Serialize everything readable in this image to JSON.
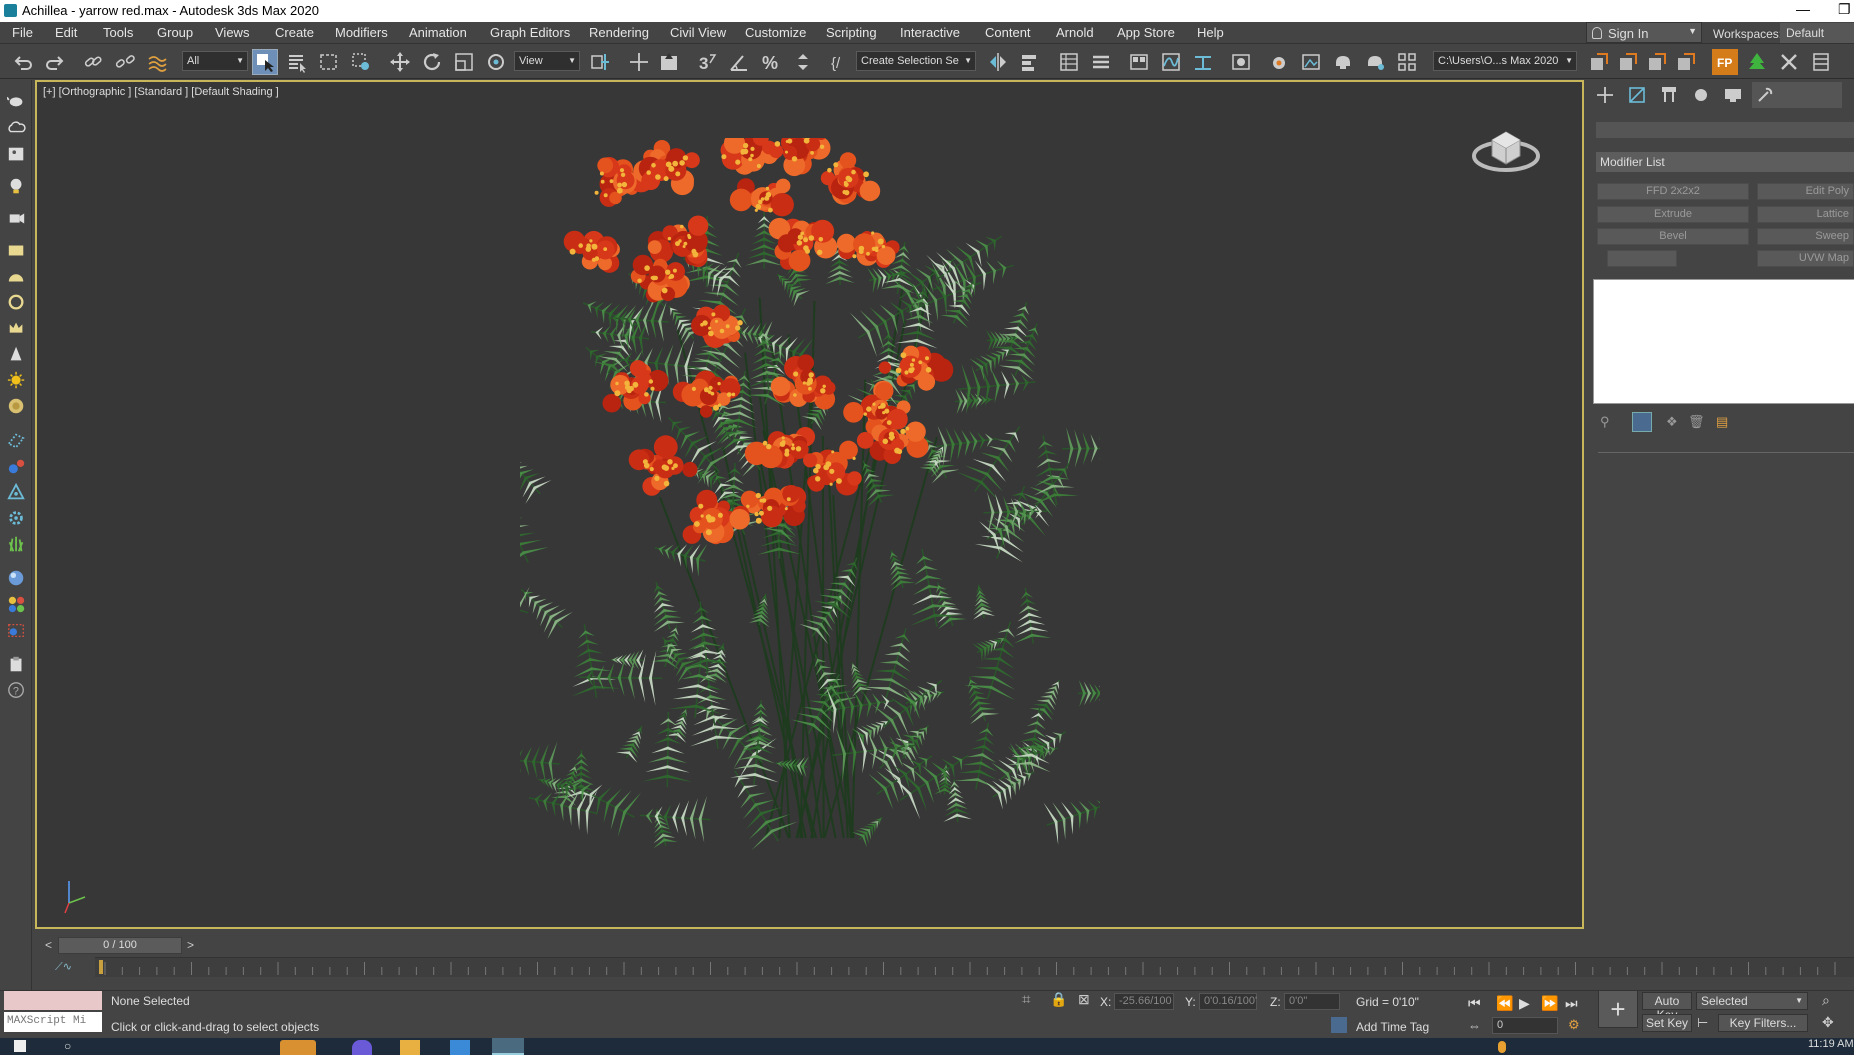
{
  "window": {
    "title": "Achillea - yarrow red.max - Autodesk 3ds Max 2020"
  },
  "menu": [
    "File",
    "Edit",
    "Tools",
    "Group",
    "Views",
    "Create",
    "Modifiers",
    "Animation",
    "Graph Editors",
    "Rendering",
    "Civil View",
    "Customize",
    "Scripting",
    "Interactive",
    "Content",
    "Arnold",
    "App Store",
    "Help"
  ],
  "account": {
    "sign_in": "Sign In",
    "workspaces_label": "Workspaces:",
    "workspace": "Default"
  },
  "toolbar": {
    "selection_filter": "All",
    "ref_coord": "View",
    "create_selection_set": "Create Selection Se",
    "project_path": "C:\\Users\\O...s Max 2020"
  },
  "viewport": {
    "label": "[+] [Orthographic ] [Standard ] [Default Shading ]"
  },
  "command_panel": {
    "modifier_list": "Modifier List",
    "buttons": [
      "FFD 2x2x2",
      "Edit Poly",
      "Extrude",
      "Lattice",
      "Bevel",
      "Sweep",
      "",
      "UVW Map"
    ]
  },
  "timeline": {
    "frame": "0 / 100",
    "prev": "<",
    "next": ">"
  },
  "status": {
    "maxscript": "MAXScript Mi",
    "selection": "None Selected",
    "prompt": "Click or click-and-drag to select objects",
    "x_label": "X:",
    "x_value": "-25.66/100",
    "y_label": "Y:",
    "y_value": "0'0.16/100'",
    "z_label": "Z:",
    "z_value": "0'0\"",
    "grid": "Grid = 0'10\"",
    "add_time_tag": "Add Time Tag",
    "auto_key": "Auto Key",
    "key_mode": "Selected",
    "set_key": "Set Key",
    "key_filters": "Key Filters...",
    "current_frame": "0"
  },
  "taskbar": {
    "clock": "11:19 AM"
  },
  "colors": {
    "viewport_bg": "#373737",
    "active_border": "#c8b65a",
    "ui_bg": "#444444",
    "flower": "#e0431e",
    "leaf": "#3d7f3a"
  }
}
